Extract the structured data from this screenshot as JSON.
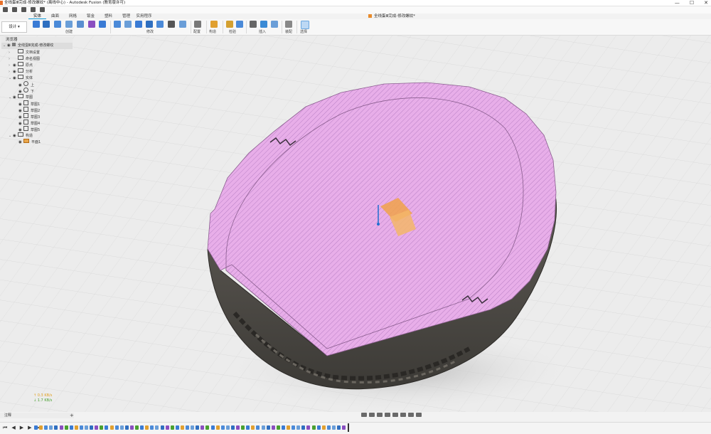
{
  "window": {
    "title": "全线蛋Ⅲ完成-修改螺纹* (离线中心) - Autodesk Fusion (教育版许可)",
    "minimize": "—",
    "maximize": "☐",
    "close": "✕"
  },
  "document_tab": {
    "label": "全线蛋Ⅲ完成-修改螺纹*"
  },
  "ribbon": {
    "workspace": "设计",
    "tabs": [
      "实体",
      "曲面",
      "网格",
      "钣金",
      "塑料",
      "管理",
      "实用程序"
    ],
    "active_tab": 0,
    "groups": [
      "创建",
      "修改",
      "配置",
      "构造",
      "检验",
      "插入",
      "装配",
      "选择"
    ]
  },
  "browser": {
    "title": "浏览器",
    "root": "全线蛋Ⅲ完成-修改螺纹",
    "rows": [
      {
        "label": "文档设置",
        "kind": "folder",
        "arrow": "›",
        "eye": false,
        "indent": 1
      },
      {
        "label": "命名视图",
        "kind": "folder",
        "arrow": "›",
        "eye": false,
        "indent": 1
      },
      {
        "label": "原点",
        "kind": "folder",
        "arrow": "›",
        "eye": true,
        "indent": 1
      },
      {
        "label": "分析",
        "kind": "folder",
        "arrow": "›",
        "eye": true,
        "indent": 1
      },
      {
        "label": "实体",
        "kind": "folder",
        "arrow": "⌄",
        "eye": true,
        "indent": 1
      },
      {
        "label": "上",
        "kind": "body",
        "arrow": "",
        "eye": true,
        "indent": 2
      },
      {
        "label": "下",
        "kind": "body",
        "arrow": "",
        "eye": true,
        "indent": 2
      },
      {
        "label": "草图",
        "kind": "folder",
        "arrow": "⌄",
        "eye": true,
        "indent": 1
      },
      {
        "label": "草图1",
        "kind": "sketch",
        "arrow": "",
        "eye": true,
        "indent": 2
      },
      {
        "label": "草图2",
        "kind": "sketch",
        "arrow": "",
        "eye": true,
        "indent": 2
      },
      {
        "label": "草图3",
        "kind": "sketch",
        "arrow": "",
        "eye": true,
        "indent": 2
      },
      {
        "label": "草图4",
        "kind": "sketch",
        "arrow": "",
        "eye": true,
        "indent": 2
      },
      {
        "label": "草图5",
        "kind": "sketch",
        "arrow": "",
        "eye": true,
        "indent": 2
      },
      {
        "label": "构造",
        "kind": "folder",
        "arrow": "⌄",
        "eye": true,
        "indent": 1
      },
      {
        "label": "平面1",
        "kind": "plane",
        "arrow": "",
        "eye": true,
        "indent": 2
      }
    ]
  },
  "measure": {
    "line1": "↑ 0.3 KB/s",
    "line2": "↓ 1.7 KB/s"
  },
  "comments": {
    "label": "注释",
    "add": "+"
  },
  "timeline": {
    "first": "⏮",
    "prev": "◀",
    "play": "▶",
    "next": "▶",
    "last": "⏭"
  },
  "colors": {
    "accent": "#0696d7",
    "section": "#e5a8e6",
    "body": "#5a5650",
    "plane": "#f0a24a"
  }
}
